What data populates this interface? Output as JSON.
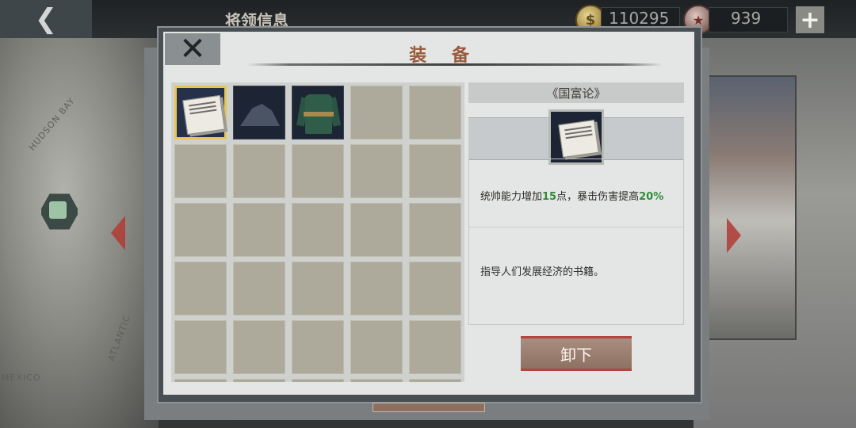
{
  "topbar": {
    "back_icon": "back-arrow-icon",
    "title": "将领信息",
    "coin_value": "110295",
    "medal_value": "939",
    "plus_icon": "plus-icon"
  },
  "background": {
    "map_labels": [
      "HUDSON BAY",
      "ATLANTIC",
      "MEXICO"
    ]
  },
  "modal": {
    "close_icon": "close-icon",
    "title": "装 备"
  },
  "inventory": {
    "columns": 5,
    "items": [
      {
        "name": "book-item",
        "icon": "book-icon",
        "selected": true
      },
      {
        "name": "coal-item",
        "icon": "coal-icon",
        "selected": false
      },
      {
        "name": "uniform-item",
        "icon": "uniform-icon",
        "selected": false
      }
    ]
  },
  "detail": {
    "name": "《国富论》",
    "effect_prefix": "统帅能力增加",
    "effect_value_1": "15",
    "effect_mid": "点，暴击伤害提高",
    "effect_value_2": "20%",
    "description": "指导人们发展经济的书籍。",
    "highlight_color": "#2f8a3a"
  },
  "actions": {
    "unequip_label": "卸下"
  }
}
